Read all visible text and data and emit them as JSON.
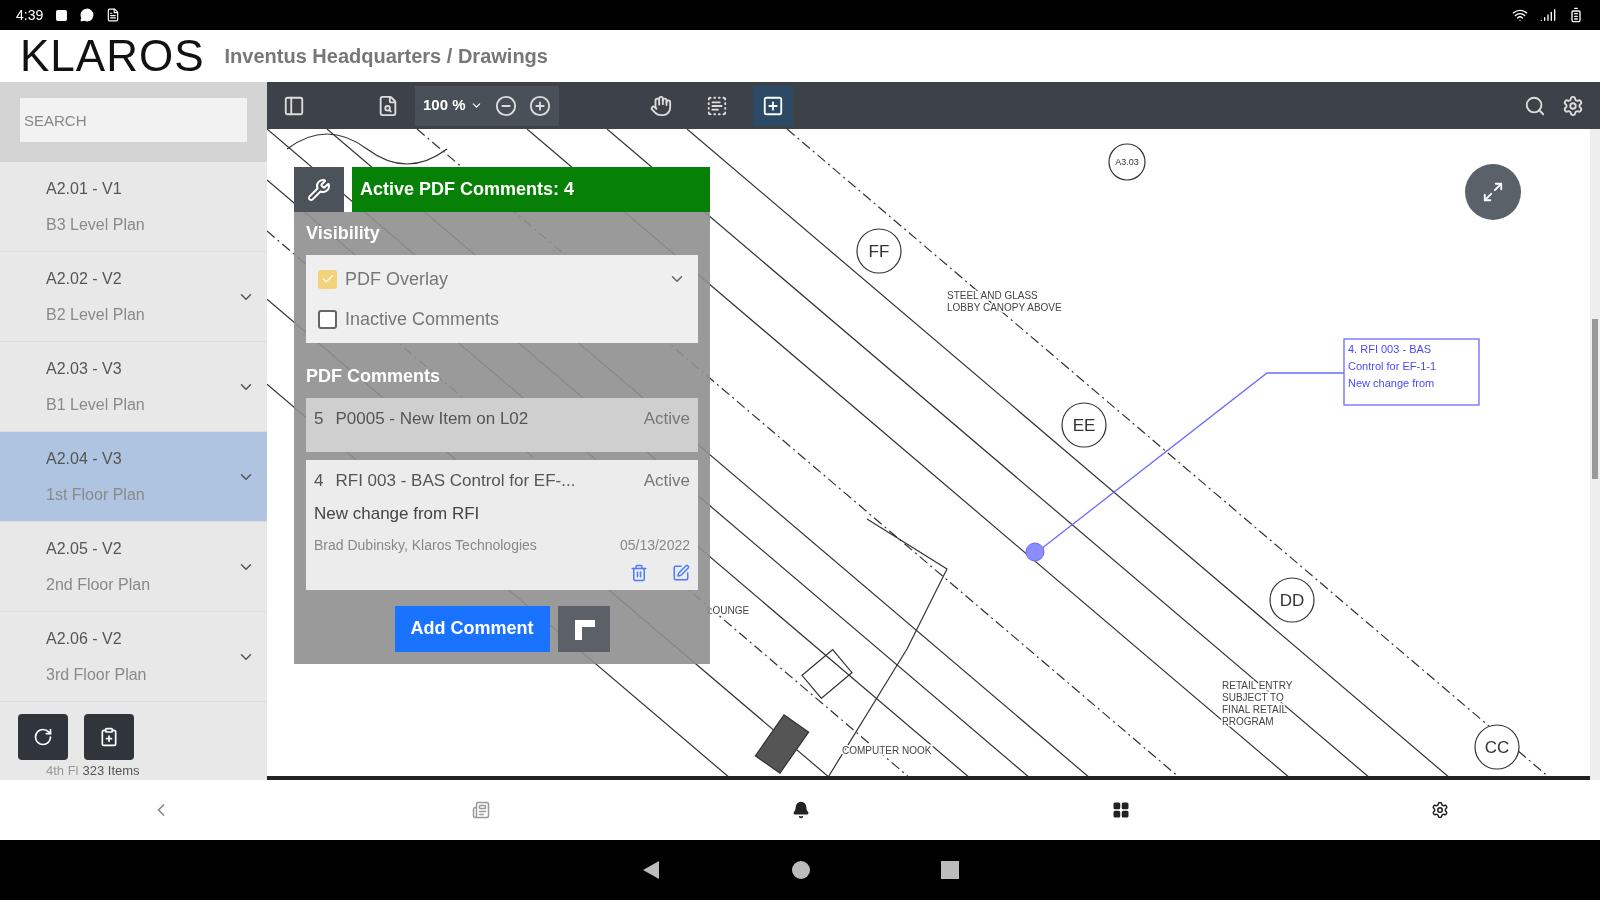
{
  "status_bar": {
    "time": "4:39"
  },
  "header": {
    "logo": "KLAROS",
    "breadcrumb": "Inventus Headquarters / Drawings"
  },
  "toolbar": {
    "zoom": "100 %",
    "tools": [
      {
        "kind": "hand",
        "selected": false
      },
      {
        "kind": "select",
        "selected": false
      },
      {
        "kind": "markup",
        "selected": true
      }
    ]
  },
  "sidebar": {
    "search": {
      "placeholder": "SEARCH"
    },
    "items": [
      {
        "code": "A2.01 - V1",
        "title": "B3 Level Plan",
        "selected": false,
        "has_versions": false
      },
      {
        "code": "A2.02 - V2",
        "title": "B2 Level Plan",
        "selected": false,
        "has_versions": true
      },
      {
        "code": "A2.03 - V3",
        "title": "B1 Level Plan",
        "selected": false,
        "has_versions": true
      },
      {
        "code": "A2.04 - V3",
        "title": "1st Floor Plan",
        "selected": true,
        "has_versions": true
      },
      {
        "code": "A2.05 - V2",
        "title": "2nd Floor Plan",
        "selected": false,
        "has_versions": true
      },
      {
        "code": "A2.06 - V2",
        "title": "3rd Floor Plan",
        "selected": false,
        "has_versions": true
      }
    ],
    "last_item_title": "4th Fl",
    "count": "323 Items"
  },
  "comments_panel": {
    "title": "Active PDF Comments: 4",
    "visibility_heading": "Visibility",
    "visibility_options": [
      {
        "label": "PDF Overlay",
        "checked": true,
        "expandable": true
      },
      {
        "label": "Inactive Comments",
        "checked": false,
        "expandable": false
      }
    ],
    "comments_heading": "PDF Comments",
    "comments": [
      {
        "number": "5",
        "title": "P0005 - New Item on L02",
        "status": "Active",
        "expanded": false
      },
      {
        "number": "4",
        "title": "RFI 003 - BAS Control for EF-...",
        "status": "Active",
        "expanded": true,
        "body": "New change from RFI",
        "author": "Brad Dubinsky, Klaros Technologies",
        "date": "05/13/2022"
      }
    ],
    "add_button": "Add Comment"
  },
  "drawing": {
    "grid_bubbles": [
      "A3.03",
      "FF",
      "EE",
      "DD",
      "CC"
    ],
    "notes": [
      {
        "lines": [
          "STEEL AND GLASS",
          "LOBBY CANOPY ABOVE"
        ]
      },
      {
        "lines": [
          "RETAIL ENTRY",
          "SUBJECT TO",
          "FINAL RETAIL",
          "PROGRAM"
        ]
      },
      {
        "lines": [
          "LOUNGE"
        ]
      },
      {
        "lines": [
          "COMPUTER NOOK"
        ]
      }
    ],
    "markup": {
      "lines": [
        "4. RFI 003 - BAS",
        "Control for EF-1-1",
        "New change from"
      ]
    }
  }
}
